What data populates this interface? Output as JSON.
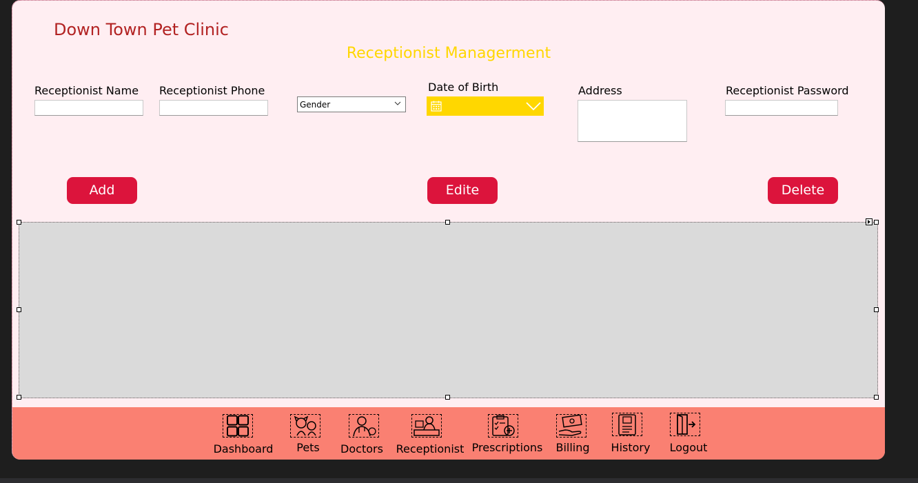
{
  "app": {
    "clinic_name": "Down Town Pet Clinic",
    "page_title": "Receptionist Managerment"
  },
  "form": {
    "name_label": "Receptionist Name",
    "phone_label": "Receptionist Phone",
    "gender_value": "Gender",
    "dob_label": "Date of Birth",
    "address_label": "Address",
    "password_label": "Receptionist Password"
  },
  "actions": {
    "add_label": "Add",
    "edit_label": "Edite",
    "delete_label": "Delete"
  },
  "nav": {
    "dashboard": "Dashboard",
    "pets": "Pets",
    "doctors": "Doctors",
    "receptionist": "Receptionist",
    "prescriptions": "Prescriptions",
    "billing": "Billing",
    "history": "History",
    "logout": "Logout"
  },
  "icons": {
    "dashboard": "grid-icon",
    "pets": "pets-icon",
    "doctors": "doctor-icon",
    "receptionist": "receptionist-icon",
    "prescriptions": "prescription-icon",
    "billing": "billing-icon",
    "history": "history-icon",
    "logout": "logout-icon",
    "calendar": "calendar-icon"
  },
  "colors": {
    "background": "#ffeef2",
    "clinic_title": "#b22222",
    "page_title": "#ffd700",
    "button": "#dc143c",
    "date_picker": "#ffd700",
    "nav_bar": "#fa8072",
    "grid": "#dadada"
  }
}
